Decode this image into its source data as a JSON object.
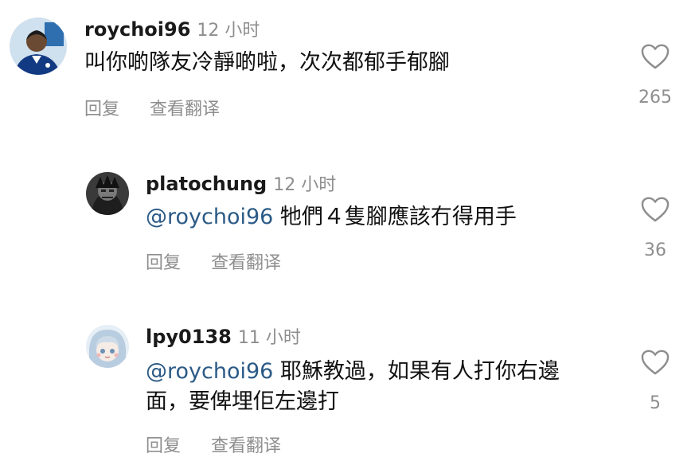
{
  "comments": [
    {
      "username": "roychoi96",
      "time": "12 小时",
      "mention": "",
      "text": "叫你啲隊友冷靜啲啦，次次都郁手郁腳",
      "reply_label": "回复",
      "translate_label": "查看翻译",
      "likes": "265"
    },
    {
      "username": "platochung",
      "time": "12 小时",
      "mention": "@roychoi96",
      "text": " 牠們４隻腳應該冇得用手",
      "reply_label": "回复",
      "translate_label": "查看翻译",
      "likes": "36"
    },
    {
      "username": "lpy0138",
      "time": "11 小时",
      "mention": "@roychoi96",
      "text": " 耶穌教過，如果有人打你右邊面，要俾埋佢左邊打",
      "reply_label": "回复",
      "translate_label": "查看翻译",
      "likes": "5"
    }
  ],
  "icons": {
    "like": "heart-outline-icon"
  },
  "colors": {
    "mention": "#2b5a86",
    "secondary_text": "#8e8e8e"
  }
}
